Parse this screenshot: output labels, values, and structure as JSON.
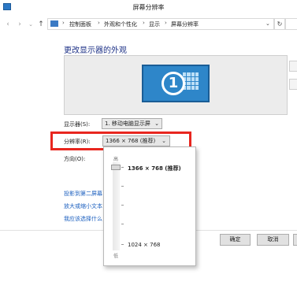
{
  "window": {
    "title": "屏幕分辨率"
  },
  "address": {
    "crumbs": [
      "控制面板",
      "外观和个性化",
      "显示",
      "屏幕分辨率"
    ],
    "separator": "›",
    "back_icon": "‹",
    "forward_icon": "›",
    "up_icon": "↑",
    "refresh_icon": "↻",
    "dropdown_icon": "⌄"
  },
  "page": {
    "heading": "更改显示器的外观"
  },
  "preview": {
    "monitor_number": "1"
  },
  "form": {
    "display_label": "显示器(S):",
    "display_value": "1. 移动电脑显示屏",
    "resolution_label": "分辨率(R):",
    "resolution_value": "1366 × 768 (推荐)",
    "orientation_label": "方向(O):",
    "select_arrow": "⌄"
  },
  "links": {
    "project": "投影到第二屏幕",
    "enlarge": "放大或缩小文本",
    "which": "我应该选择什么"
  },
  "buttons": {
    "ok": "确定",
    "cancel": "取消"
  },
  "dropdown": {
    "high_label": "高",
    "low_label": "低",
    "option_high": "1366 × 768 (推荐)",
    "option_low": "1024 × 768"
  }
}
